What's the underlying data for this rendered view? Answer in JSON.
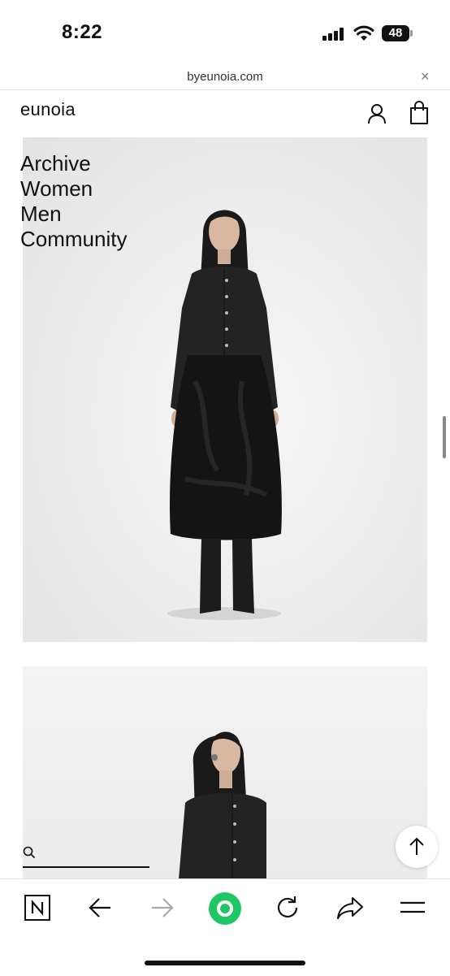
{
  "status_bar": {
    "time": "8:22",
    "battery": "48"
  },
  "browser": {
    "url": "byeunoia.com",
    "close_symbol": "×"
  },
  "site": {
    "brand": "eunoia",
    "nav": [
      "Archive",
      "Women",
      "Men",
      "Community"
    ]
  },
  "icons": {
    "account": "person-icon",
    "bag": "shopping-bag-icon",
    "search": "search-icon",
    "top": "arrow-up-icon",
    "toolbar": [
      "naver-n-icon",
      "back-arrow-icon",
      "forward-arrow-icon",
      "green-dot-icon",
      "reload-icon",
      "share-icon",
      "menu-icon"
    ]
  },
  "colors": {
    "accent_green": "#1ec764",
    "text": "#111111"
  }
}
